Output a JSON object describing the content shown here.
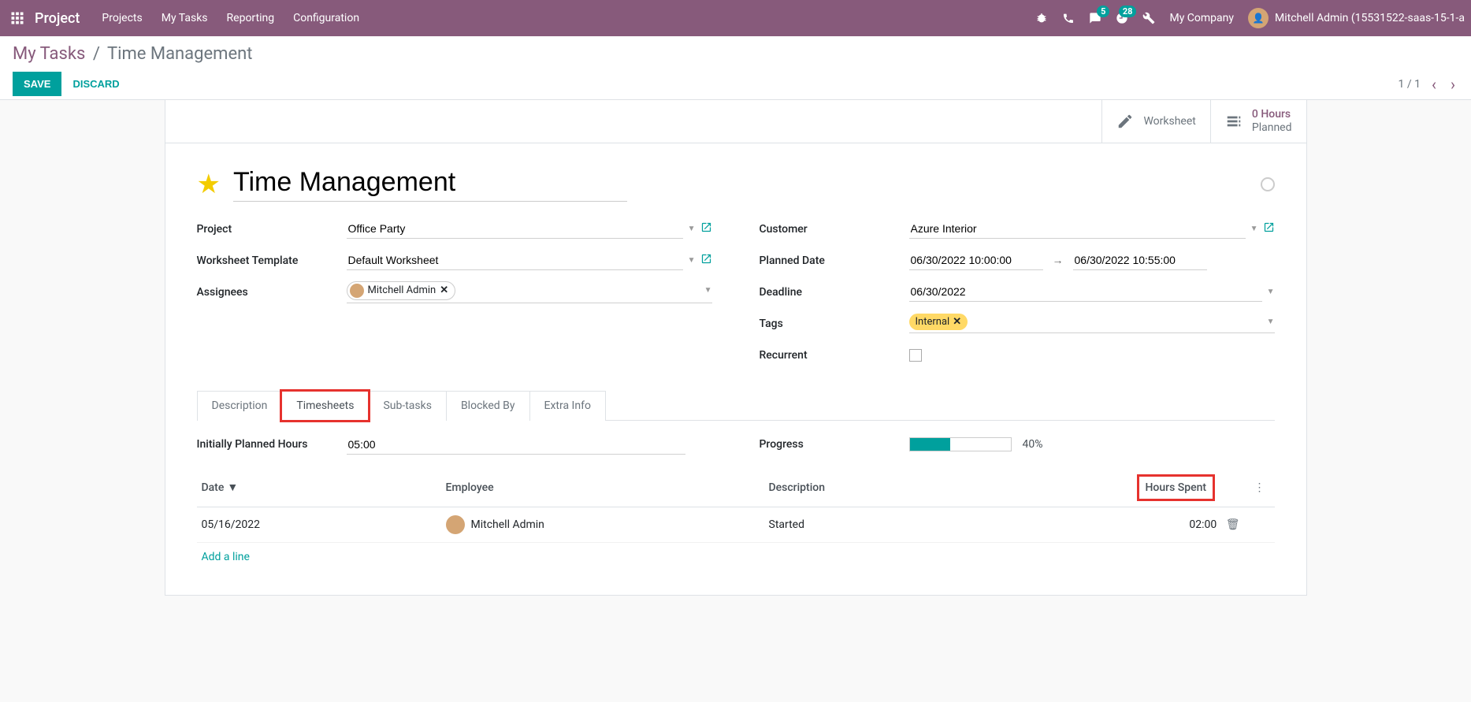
{
  "nav": {
    "brand": "Project",
    "menu": [
      "Projects",
      "My Tasks",
      "Reporting",
      "Configuration"
    ],
    "company": "My Company",
    "user": "Mitchell Admin (15531522-saas-15-1-a",
    "msg_badge": "5",
    "activity_badge": "28"
  },
  "breadcrumb": {
    "root": "My Tasks",
    "current": "Time Management"
  },
  "actions": {
    "save": "SAVE",
    "discard": "DISCARD",
    "pager": "1 / 1"
  },
  "stat": {
    "worksheet": "Worksheet",
    "hours_val": "0",
    "hours_unit": "Hours",
    "planned": "Planned"
  },
  "task": {
    "title": "Time Management",
    "labels": {
      "project": "Project",
      "worksheet_template": "Worksheet Template",
      "assignees": "Assignees",
      "customer": "Customer",
      "planned_date": "Planned Date",
      "deadline": "Deadline",
      "tags": "Tags",
      "recurrent": "Recurrent"
    },
    "project": "Office Party",
    "worksheet_template": "Default Worksheet",
    "assignee": "Mitchell Admin",
    "customer": "Azure Interior",
    "planned_start": "06/30/2022 10:00:00",
    "planned_end": "06/30/2022 10:55:00",
    "deadline": "06/30/2022",
    "tag": "Internal"
  },
  "tabs": [
    "Description",
    "Timesheets",
    "Sub-tasks",
    "Blocked By",
    "Extra Info"
  ],
  "timesheet": {
    "planned_label": "Initially Planned Hours",
    "planned_value": "05:00",
    "progress_label": "Progress",
    "progress_pct": "40%",
    "progress_fill": 40,
    "columns": {
      "date": "Date",
      "employee": "Employee",
      "description": "Description",
      "hours": "Hours Spent"
    },
    "rows": [
      {
        "date": "05/16/2022",
        "employee": "Mitchell Admin",
        "description": "Started",
        "hours": "02:00"
      }
    ],
    "add_line": "Add a line"
  }
}
